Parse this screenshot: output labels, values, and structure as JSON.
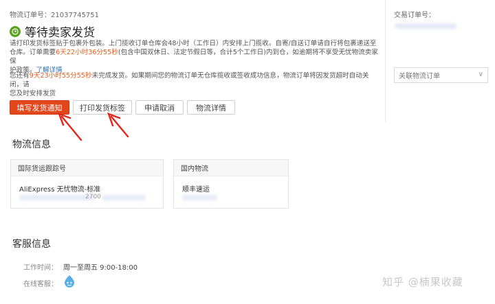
{
  "order": {
    "logistics_no_label": "物流订单号：",
    "logistics_no": "21037745751",
    "status_title": "等待卖家发货",
    "instruction_lines": [
      "请打印发货标签贴于包裹外包装。上门揽收订单仓库会48小时（工作日）内安排上门揽收。自寄/自送订单请自行将包裹递送至",
      "仓库。订单需要",
      "(包含中国双休日、法定节假日等，合计5个工作日)内到仓，如逾期将不享受无忧物流卖家保",
      "护政策。"
    ],
    "deadline_red": "6天22小时36分55秒",
    "policy_link": "了解详情",
    "remain_prefix": "您还有",
    "remain_time": "9天23小时55分55秒",
    "remain_suffix": "未完成发货。如果期间您的物流订单无仓库揽收或签收成功信息，物流订单将因发货超时自动关闭，请",
    "remain_line2": "您及时安排发货"
  },
  "buttons": {
    "fill_notice": "填写发货通知",
    "print_label": "打印发货标签",
    "cancel": "申请取消",
    "details": "物流详情"
  },
  "right_panel": {
    "trade_order_label": "交易订单号：",
    "related_select": "关联物流订单"
  },
  "logistics": {
    "section_title": "物流信息",
    "international": {
      "header": "国际货运跟踪号",
      "service": "AliExpress 无忧物流-标准",
      "tracking_fragment": "2700"
    },
    "domestic": {
      "header": "国内物流",
      "carrier": "顺丰速运"
    }
  },
  "service": {
    "section_title": "客服信息",
    "hours_label": "工作时间：",
    "hours_value": "周一至周五 9:00-18:00",
    "online_label": "在线客服："
  },
  "watermark": "知乎 @楠果收藏",
  "colors": {
    "primary_button": "#e4461c",
    "status_green": "#5aa21f",
    "annotation_arrow": "#e02a1f",
    "highlight_orange": "#e85d1b"
  }
}
